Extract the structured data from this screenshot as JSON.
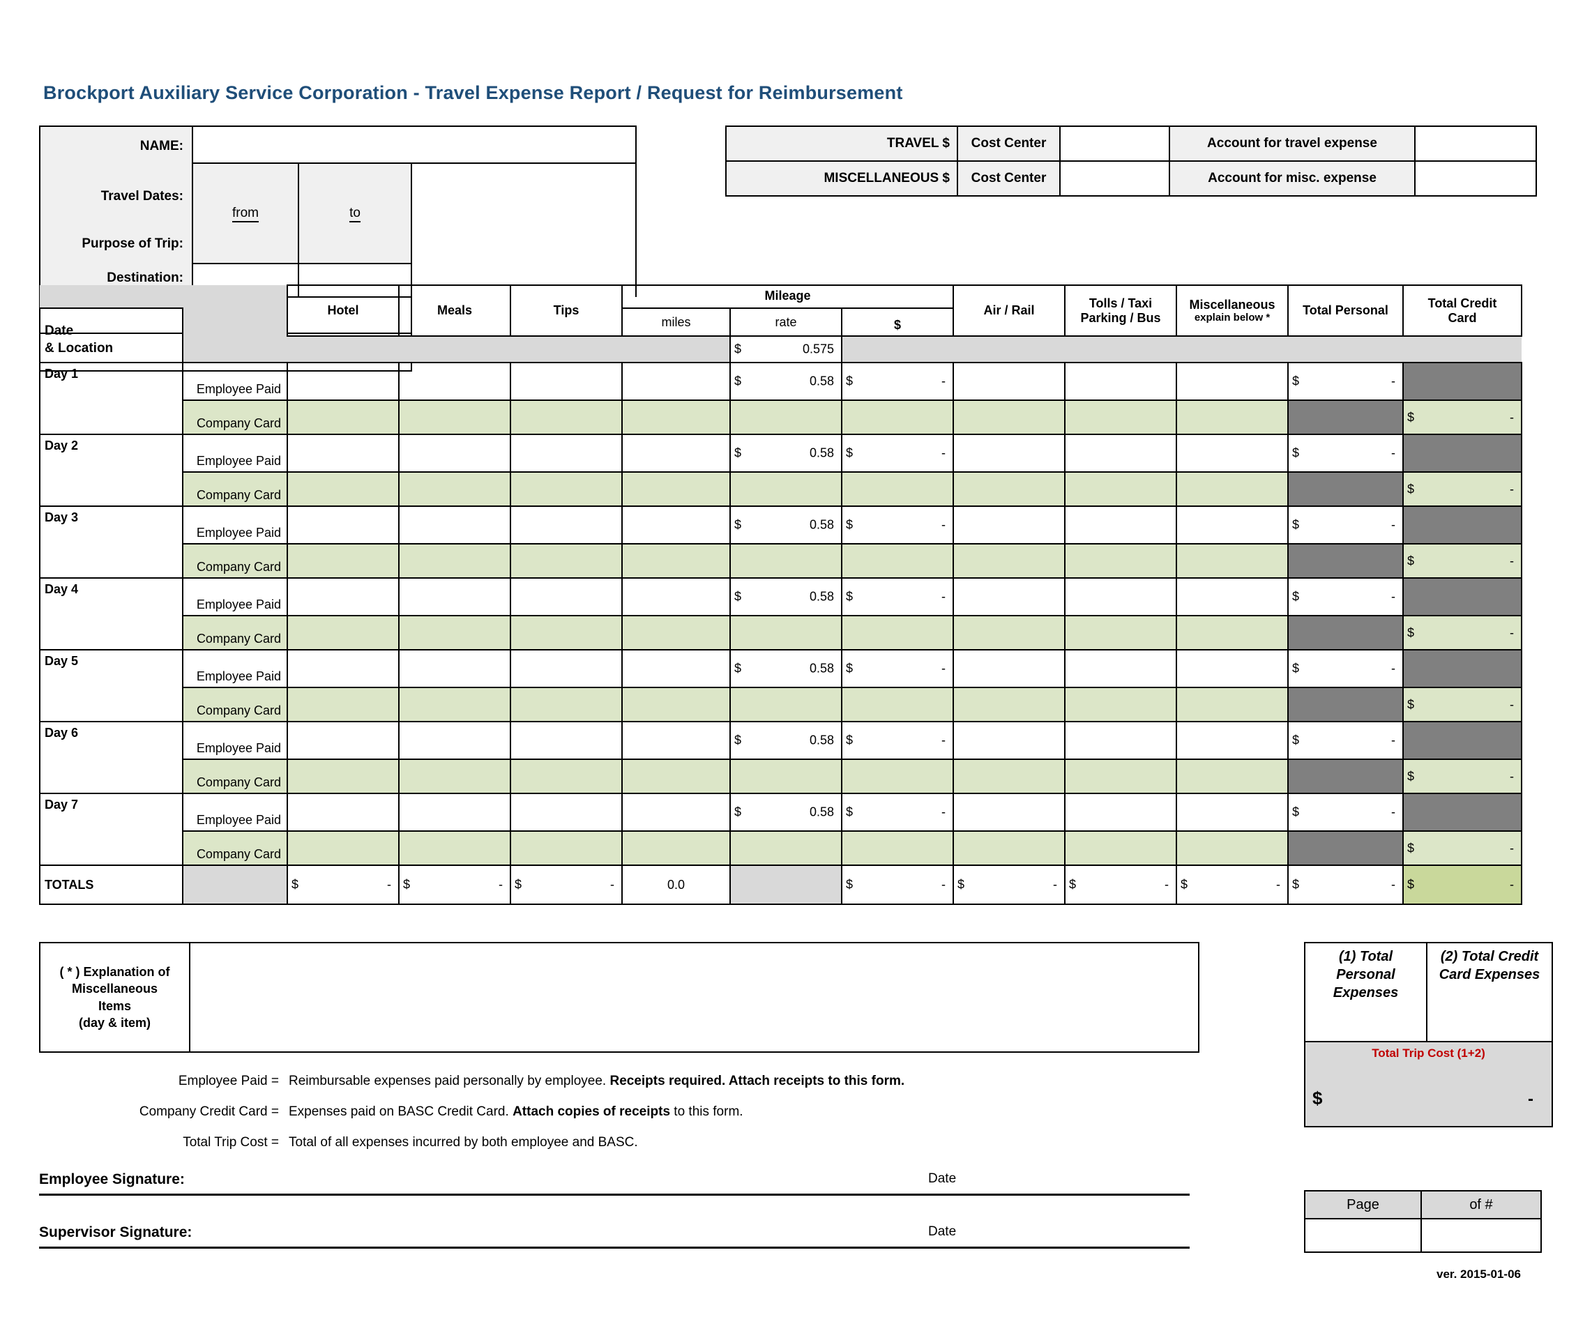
{
  "document": {
    "title": "Brockport Auxiliary Service Corporation  - Travel Expense Report / Request for Reimbursement",
    "version": "ver. 2015-01-06"
  },
  "colors": {
    "title_blue": "#1F4E79",
    "header_gray": "#F0F0F0",
    "fill_gray": "#D9D9D9",
    "blocked_dark_gray": "#808080",
    "company_card_green": "#DCE6C8",
    "total_green": "#C9D89B",
    "total_trip_red": "#C00000"
  },
  "info": {
    "name_label": "NAME:",
    "name_value": "",
    "travel_dates_label": "Travel Dates:",
    "from_label": "from",
    "to_label": "to",
    "from_value": "",
    "to_value": "",
    "purpose_label": "Purpose of Trip:",
    "purpose_value": "",
    "destination_label": "Destination:",
    "destination_value": ""
  },
  "accounts": {
    "rows": [
      {
        "amount_label": "TRAVEL $",
        "amount_value": "",
        "cost_center_label": "Cost Center",
        "cost_center_value": "",
        "account_label": "Account for travel expense",
        "account_value": ""
      },
      {
        "amount_label": "MISCELLANEOUS $",
        "amount_value": "",
        "cost_center_label": "Cost Center",
        "cost_center_value": "",
        "account_label": "Account for misc. expense",
        "account_value": ""
      }
    ]
  },
  "table": {
    "headers": {
      "date_location": "Date\n& Location",
      "date_line1": "Date",
      "date_line2": "& Location",
      "hotel": "Hotel",
      "meals": "Meals",
      "tips": "Tips",
      "mileage": "Mileage",
      "miles": "miles",
      "rate": "rate",
      "dollar": "$",
      "air_rail": "Air / Rail",
      "tolls_line1": "Tolls / Taxi",
      "tolls_line2": "Parking / Bus",
      "misc_line1": "Miscellaneous",
      "misc_line2": "explain below *",
      "total_personal": "Total Personal",
      "total_credit_line1": "Total Credit",
      "total_credit_line2": "Card"
    },
    "rate_row": {
      "currency": "$",
      "rate": "0.575"
    },
    "pay_types": {
      "employee": "Employee Paid",
      "company": "Company Card"
    },
    "row_rate_display": "0.58",
    "currency": "$",
    "dash": "-",
    "days": [
      {
        "label": "Day 1",
        "date_location": "",
        "hotel": "",
        "meals": "",
        "tips": "",
        "miles": "",
        "rate": "0.58",
        "mileage_amount": "-",
        "air_rail": "",
        "tolls": "",
        "misc": "",
        "total_personal": "-",
        "total_credit": "-"
      },
      {
        "label": "Day 2",
        "date_location": "",
        "hotel": "",
        "meals": "",
        "tips": "",
        "miles": "",
        "rate": "0.58",
        "mileage_amount": "-",
        "air_rail": "",
        "tolls": "",
        "misc": "",
        "total_personal": "-",
        "total_credit": "-"
      },
      {
        "label": "Day 3",
        "date_location": "",
        "hotel": "",
        "meals": "",
        "tips": "",
        "miles": "",
        "rate": "0.58",
        "mileage_amount": "-",
        "air_rail": "",
        "tolls": "",
        "misc": "",
        "total_personal": "-",
        "total_credit": "-"
      },
      {
        "label": "Day 4",
        "date_location": "",
        "hotel": "",
        "meals": "",
        "tips": "",
        "miles": "",
        "rate": "0.58",
        "mileage_amount": "-",
        "air_rail": "",
        "tolls": "",
        "misc": "",
        "total_personal": "-",
        "total_credit": "-"
      },
      {
        "label": "Day 5",
        "date_location": "",
        "hotel": "",
        "meals": "",
        "tips": "",
        "miles": "",
        "rate": "0.58",
        "mileage_amount": "-",
        "air_rail": "",
        "tolls": "",
        "misc": "",
        "total_personal": "-",
        "total_credit": "-"
      },
      {
        "label": "Day 6",
        "date_location": "",
        "hotel": "",
        "meals": "",
        "tips": "",
        "miles": "",
        "rate": "0.58",
        "mileage_amount": "-",
        "air_rail": "",
        "tolls": "",
        "misc": "",
        "total_personal": "-",
        "total_credit": "-"
      },
      {
        "label": "Day 7",
        "date_location": "",
        "hotel": "",
        "meals": "",
        "tips": "",
        "miles": "",
        "rate": "0.58",
        "mileage_amount": "-",
        "air_rail": "",
        "tolls": "",
        "misc": "",
        "total_personal": "-",
        "total_credit": "-"
      }
    ],
    "totals": {
      "label": "TOTALS",
      "hotel": "-",
      "meals": "-",
      "tips": "-",
      "miles": "0.0",
      "mileage_amount": "-",
      "air_rail": "-",
      "tolls": "-",
      "misc": "-",
      "total_personal": "-",
      "total_credit": "-"
    }
  },
  "explanation": {
    "caption_line1": "( * ) Explanation of",
    "caption_line2": "Miscellaneous",
    "caption_line3": "Items",
    "caption_line4": "(day & item)",
    "value": ""
  },
  "summary": {
    "personal_line1": "(1) Total",
    "personal_line2": "Personal",
    "personal_line3": "Expenses",
    "personal_value": "",
    "credit_line1": "(2) Total Credit",
    "credit_line2": "Card Expenses",
    "credit_value": "",
    "total_trip_label": "Total Trip Cost (1+2)",
    "total_trip_currency": "$",
    "total_trip_value": "-"
  },
  "notes": [
    {
      "key": "Employee Paid =",
      "plain1": "Reimbursable expenses paid personally by employee. ",
      "bold": "Receipts required. Attach receipts to this form.",
      "plain2": ""
    },
    {
      "key": "Company Credit Card =",
      "plain1": "Expenses paid on BASC Credit Card. ",
      "bold": "Attach copies of receipts",
      "plain2": " to this form."
    },
    {
      "key": "Total Trip Cost =",
      "plain1": "Total of all expenses incurred by both employee and BASC.",
      "bold": "",
      "plain2": ""
    }
  ],
  "signatures": {
    "employee_label": "Employee Signature:",
    "employee_date_label": "Date",
    "supervisor_label": "Supervisor Signature:",
    "supervisor_date_label": "Date"
  },
  "page_box": {
    "page_label": "Page",
    "of_label": "of #",
    "page_value": "",
    "of_value": ""
  }
}
